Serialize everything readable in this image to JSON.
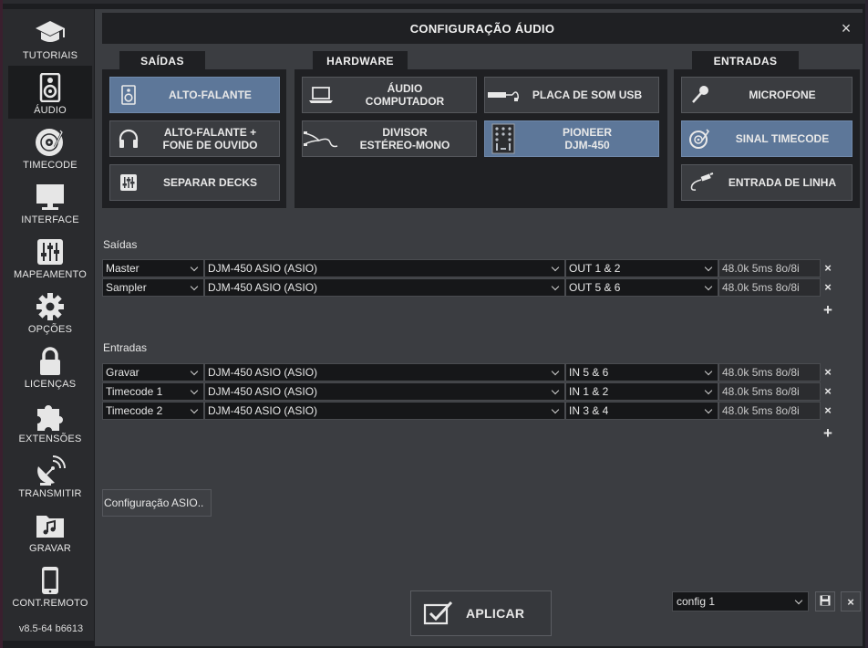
{
  "sidebar": {
    "items": [
      {
        "label": "TUTORIAIS",
        "icon": "graduation-cap-icon"
      },
      {
        "label": "ÁUDIO",
        "icon": "speaker-icon"
      },
      {
        "label": "TIMECODE",
        "icon": "vinyl-icon"
      },
      {
        "label": "INTERFACE",
        "icon": "monitor-icon"
      },
      {
        "label": "MAPEAMENTO",
        "icon": "sliders-icon"
      },
      {
        "label": "OPÇÕES",
        "icon": "gear-icon"
      },
      {
        "label": "LICENÇAS",
        "icon": "lock-icon"
      },
      {
        "label": "EXTENSÕES",
        "icon": "puzzle-icon"
      },
      {
        "label": "TRANSMITIR",
        "icon": "satellite-dish-icon"
      },
      {
        "label": "GRAVAR",
        "icon": "music-folder-icon"
      },
      {
        "label": "CONT.REMOTO",
        "icon": "phone-icon"
      }
    ],
    "active": "ÁUDIO",
    "version": "v8.5-64 b6613"
  },
  "window": {
    "title": "CONFIGURAÇÃO ÁUDIO",
    "close_label": "×"
  },
  "groups": {
    "saidas": {
      "title": "SAÍDAS",
      "buttons": [
        {
          "label": "ALTO-FALANTE",
          "icon": "speaker-icon",
          "selected": true
        },
        {
          "label": "ALTO-FALANTE +\nFONE DE OUVIDO",
          "icon": "headphones-icon",
          "selected": false
        },
        {
          "label": "SEPARAR DECKS",
          "icon": "mixer-icon",
          "selected": false
        }
      ]
    },
    "hardware": {
      "title": "HARDWARE",
      "buttons": [
        {
          "label": "ÁUDIO\nCOMPUTADOR",
          "icon": "laptop-icon",
          "selected": false
        },
        {
          "label": "PLACA DE SOM USB",
          "icon": "usb-soundcard-icon",
          "selected": false
        },
        {
          "label": "DIVISOR\nESTÉREO-MONO",
          "icon": "splitter-cable-icon",
          "selected": false
        },
        {
          "label": "PIONEER\nDJM-450",
          "icon": "dj-mixer-icon",
          "selected": true
        }
      ]
    },
    "entradas": {
      "title": "ENTRADAS",
      "buttons": [
        {
          "label": "MICROFONE",
          "icon": "microphone-icon",
          "selected": false
        },
        {
          "label": "SINAL TIMECODE",
          "icon": "timecode-vinyl-icon",
          "selected": true
        },
        {
          "label": "ENTRADA DE LINHA",
          "icon": "line-cable-icon",
          "selected": false
        }
      ]
    }
  },
  "outputs": {
    "label": "Saídas",
    "rows": [
      {
        "channel": "Master",
        "device": "DJM-450 ASIO (ASIO)",
        "port": "OUT 1 & 2",
        "info": "48.0k 5ms 8o/8i"
      },
      {
        "channel": "Sampler",
        "device": "DJM-450 ASIO (ASIO)",
        "port": "OUT 5 & 6",
        "info": "48.0k 5ms 8o/8i"
      }
    ],
    "add_label": "+"
  },
  "inputs": {
    "label": "Entradas",
    "rows": [
      {
        "channel": "Gravar",
        "device": "DJM-450 ASIO (ASIO)",
        "port": "IN 5 & 6",
        "info": "48.0k 5ms 8o/8i"
      },
      {
        "channel": "Timecode 1",
        "device": "DJM-450 ASIO (ASIO)",
        "port": "IN 1 & 2",
        "info": "48.0k 5ms 8o/8i"
      },
      {
        "channel": "Timecode 2",
        "device": "DJM-450 ASIO (ASIO)",
        "port": "IN 3 & 4",
        "info": "48.0k 5ms 8o/8i"
      }
    ],
    "add_label": "+"
  },
  "remove_label": "×",
  "asio_button": "Configuração ASIO..",
  "apply_button": "APLICAR",
  "config": {
    "selected": "config 1",
    "close_label": "×"
  }
}
